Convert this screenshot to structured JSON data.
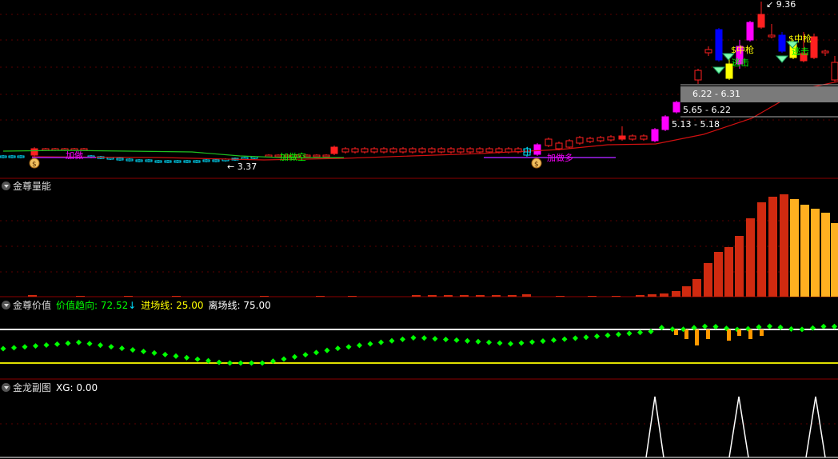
{
  "colors": {
    "up": "#ff2020",
    "down": "#00e0ff",
    "magenta": "#ff00ff",
    "blue": "#0000ff",
    "yellow": "#ffff00",
    "orange": "#ff9900",
    "green": "#00ff00",
    "purple": "#a020f0",
    "dark_red": "#8b0000",
    "white": "#ffffff",
    "gray": "#b0b0b0"
  },
  "main": {
    "high_label": "9.36",
    "low_label": "3.37",
    "zones": [
      "6.22 - 6.31",
      "5.65 - 6.22",
      "5.13 - 5.18"
    ],
    "signals": {
      "add_short": "加做空",
      "add_long": "加做多",
      "add_flag": "加做",
      "middle": "中",
      "grab": "$中枪",
      "jab": "逃击"
    },
    "icons": [
      "money-bag-icon",
      "diamond-icon"
    ]
  },
  "panel1": {
    "title": "金尊量能"
  },
  "panel2": {
    "title": "金尊价值",
    "trend_label": "价值趋向: 72.52",
    "entry_label": "进场线: 25.00",
    "exit_label": "离场线: 75.00"
  },
  "panel3": {
    "title": "金龙副图",
    "xg_label": "XG: 0.00"
  }
}
